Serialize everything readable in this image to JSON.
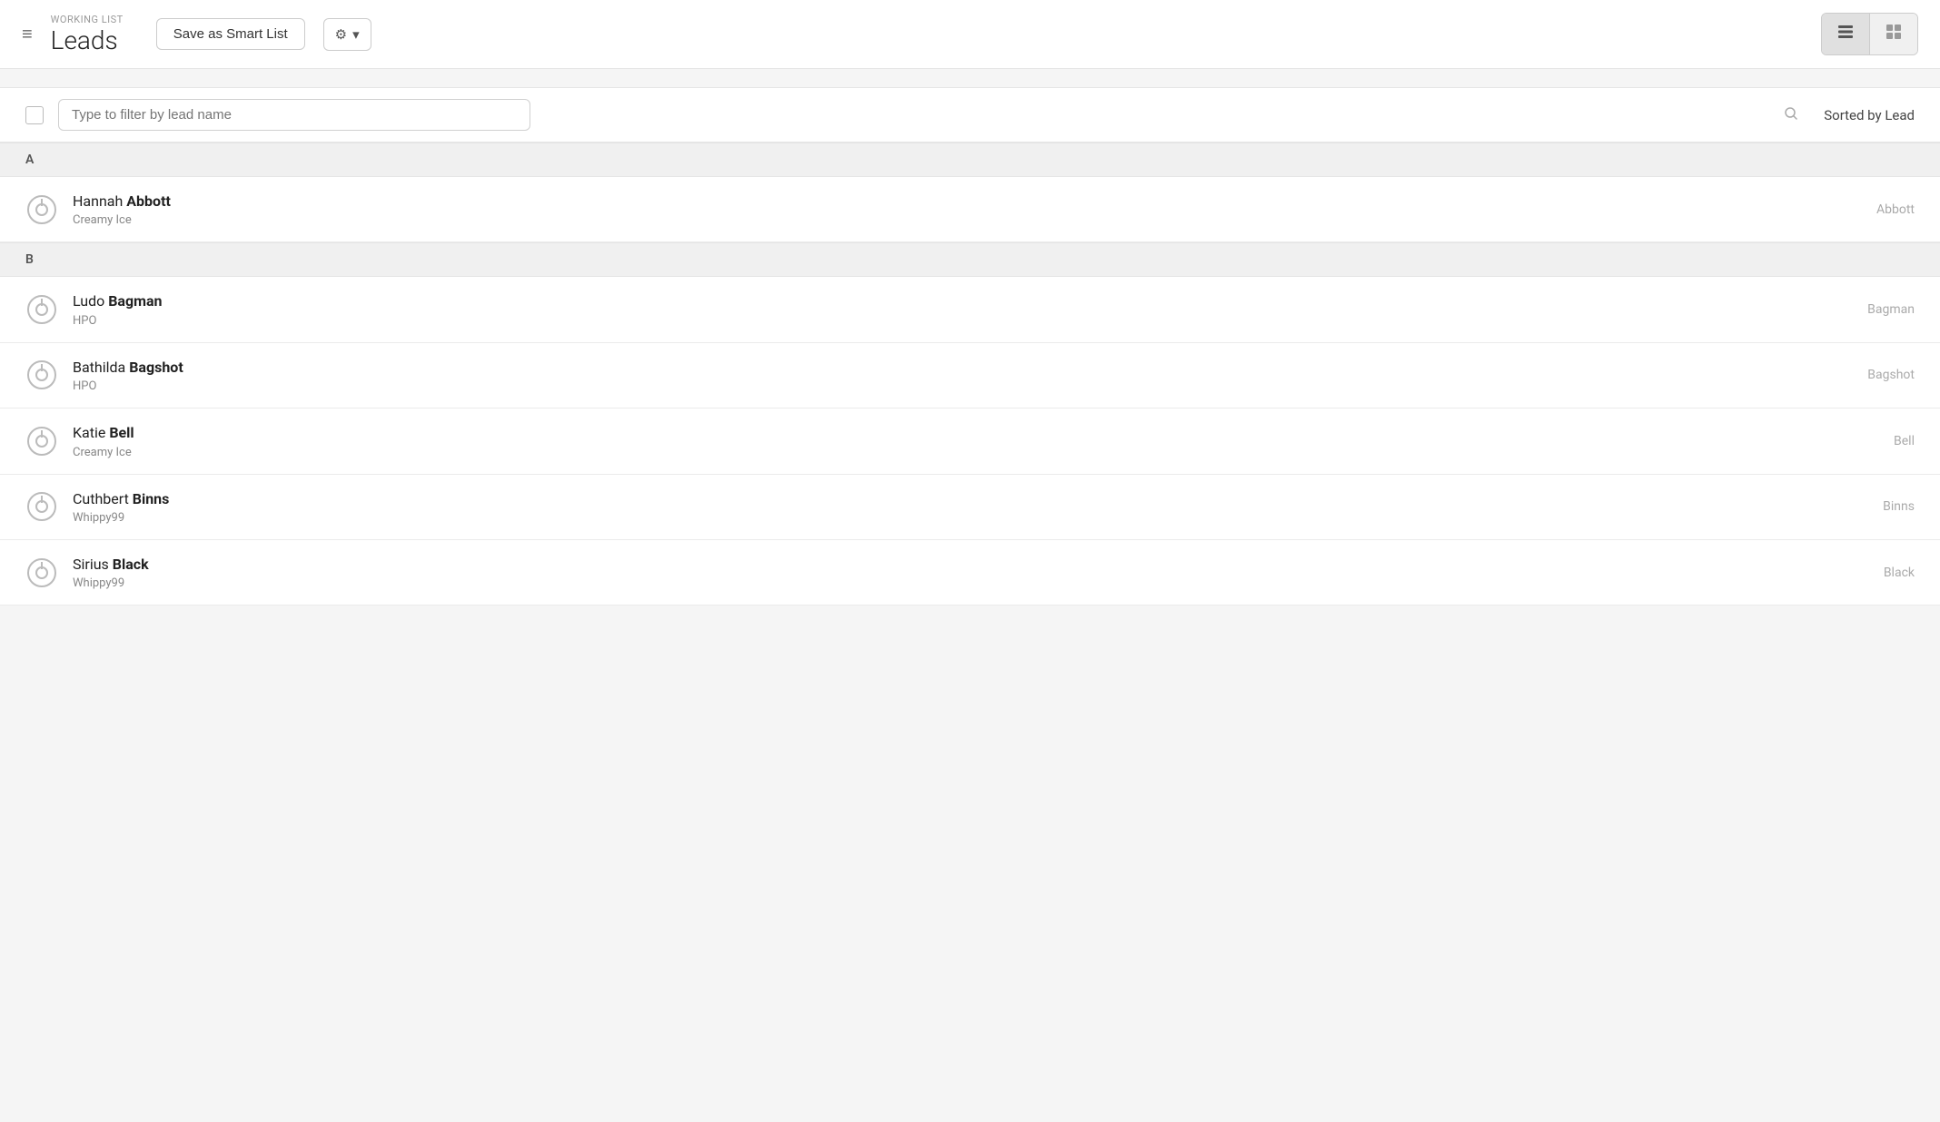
{
  "header": {
    "menu_icon": "≡",
    "subtitle": "WORKING LIST",
    "title": "Leads",
    "save_button_label": "Save as Smart List",
    "gear_icon_label": "⚙",
    "chevron_down": "▾",
    "view_list_icon": "▦",
    "view_grid_icon": "▪▪"
  },
  "filter": {
    "search_placeholder": "Type to filter by lead name",
    "sort_label": "Sorted by Lead",
    "search_icon": "🔍"
  },
  "sections": [
    {
      "letter": "A",
      "items": [
        {
          "first_name": "Hannah",
          "last_name": "Abbott",
          "company": "Creamy Ice",
          "sort_value": "Abbott"
        }
      ]
    },
    {
      "letter": "B",
      "items": [
        {
          "first_name": "Ludo",
          "last_name": "Bagman",
          "company": "HPO",
          "sort_value": "Bagman"
        },
        {
          "first_name": "Bathilda",
          "last_name": "Bagshot",
          "company": "HPO",
          "sort_value": "Bagshot"
        },
        {
          "first_name": "Katie",
          "last_name": "Bell",
          "company": "Creamy Ice",
          "sort_value": "Bell"
        },
        {
          "first_name": "Cuthbert",
          "last_name": "Binns",
          "company": "Whippy99",
          "sort_value": "Binns"
        },
        {
          "first_name": "Sirius",
          "last_name": "Black",
          "company": "Whippy99",
          "sort_value": "Black"
        }
      ]
    }
  ]
}
